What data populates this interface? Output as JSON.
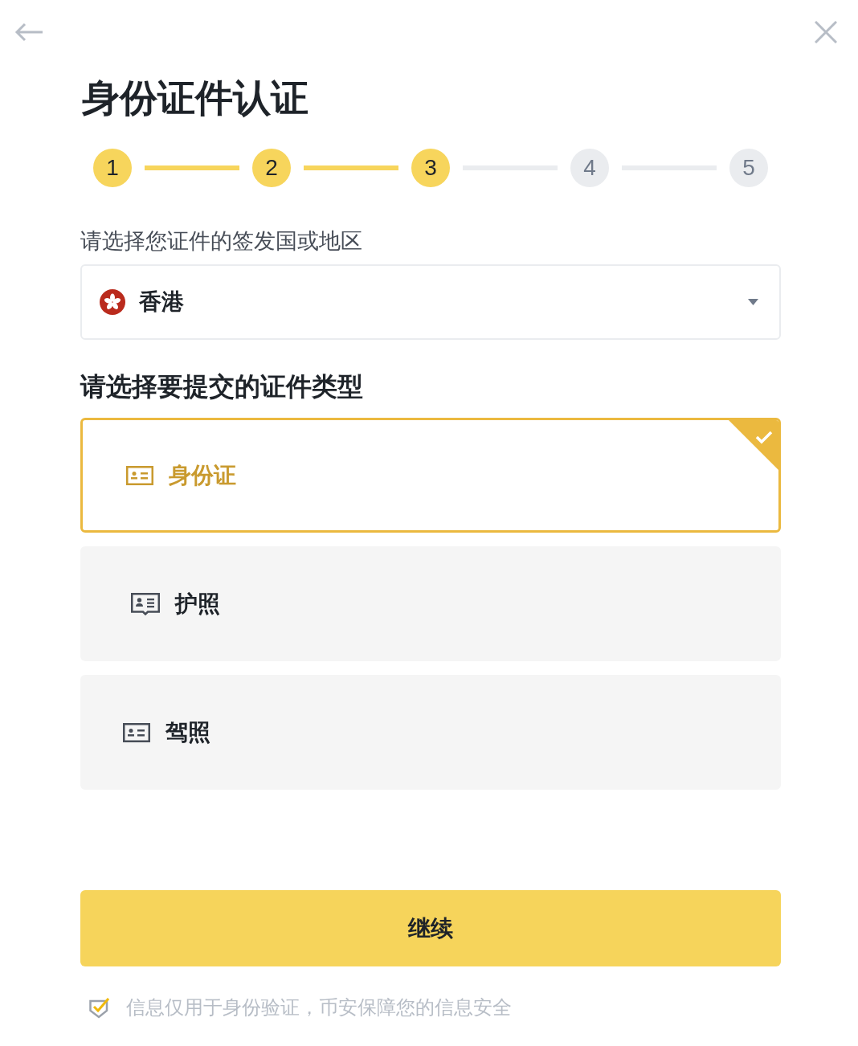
{
  "header": {
    "title": "身份证件认证"
  },
  "steps": [
    {
      "label": "1",
      "active": true
    },
    {
      "label": "2",
      "active": true
    },
    {
      "label": "3",
      "active": true
    },
    {
      "label": "4",
      "active": false
    },
    {
      "label": "5",
      "active": false
    }
  ],
  "country": {
    "label": "请选择您证件的签发国或地区",
    "value": "香港"
  },
  "document_types": {
    "heading": "请选择要提交的证件类型",
    "options": [
      {
        "kind": "id-card",
        "label": "身份证",
        "selected": true
      },
      {
        "kind": "passport",
        "label": "护照",
        "selected": false
      },
      {
        "kind": "license",
        "label": "驾照",
        "selected": false
      }
    ]
  },
  "continue_button": "继续",
  "footer_note": "信息仅用于身份验证，币安保障您的信息安全"
}
